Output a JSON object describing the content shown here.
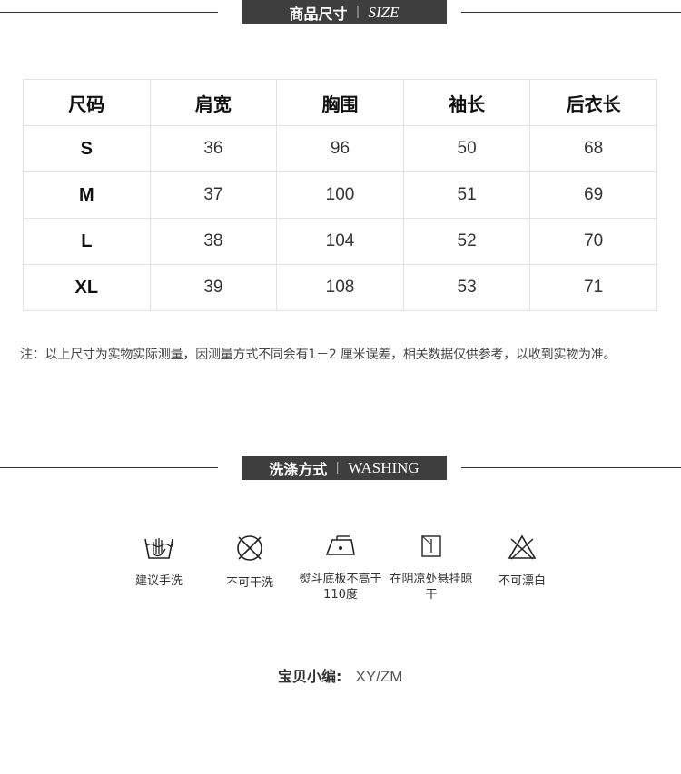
{
  "size_section": {
    "title_cn": "商品尺寸",
    "separator": "|",
    "title_en": "SIZE"
  },
  "size_table": {
    "headers": [
      "尺码",
      "肩宽",
      "胸围",
      "袖长",
      "后衣长"
    ],
    "rows": [
      [
        "S",
        "36",
        "96",
        "50",
        "68"
      ],
      [
        "M",
        "37",
        "100",
        "51",
        "69"
      ],
      [
        "L",
        "38",
        "104",
        "52",
        "70"
      ],
      [
        "XL",
        "39",
        "108",
        "53",
        "71"
      ]
    ]
  },
  "note": "注：以上尺寸为实物实际测量，因测量方式不同会有1－2 厘米误差，相关数据仅供参考，以收到实物为准。",
  "wash_section": {
    "title_cn": "洗涤方式",
    "separator": "|",
    "title_en": "WASHING"
  },
  "wash_items": [
    {
      "icon": "hand-wash-icon",
      "label": "建议手洗"
    },
    {
      "icon": "no-dry-clean-icon",
      "label": "不可干洗"
    },
    {
      "icon": "iron-low-icon",
      "label": "熨斗底板不高于110度"
    },
    {
      "icon": "shade-dry-icon",
      "label": "在阴凉处悬挂晾干"
    },
    {
      "icon": "no-bleach-icon",
      "label": "不可漂白"
    }
  ],
  "editor": {
    "label": "宝贝小编:",
    "value": "XY/ZM"
  }
}
